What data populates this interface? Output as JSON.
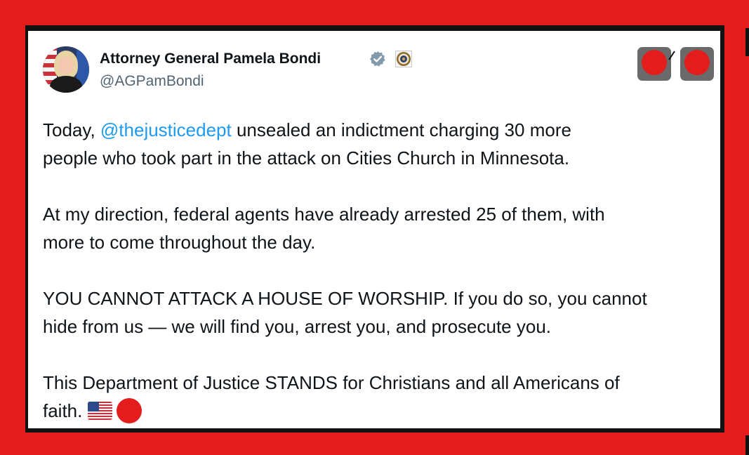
{
  "post": {
    "author_name": "Attorney General Pamela Bondi",
    "handle": "@AGPamBondi",
    "paragraph1": {
      "prefix": "Today, ",
      "mention": "@thejusticedept",
      "line1_rest": " unsealed an indictment charging 30 more",
      "line2": "people who took part in the attack on Cities Church in Minnesota."
    },
    "paragraph2": {
      "line1": "At my direction, federal agents have already arrested 25 of them, with",
      "line2": "more to come throughout the day."
    },
    "paragraph3": {
      "line1": "YOU CANNOT ATTACK A HOUSE OF WORSHIP. If you do so, you cannot",
      "line2": "hide from us — we will find you, arrest you, and prosecute you."
    },
    "paragraph4": {
      "line1": "This Department of Justice STANDS for Christians and all Americans of",
      "line2": "faith."
    }
  },
  "icons": {
    "verified": "verified-badge-icon",
    "seal": "doj-seal-icon",
    "flag": "us-flag-emoji-icon"
  },
  "colors": {
    "frame": "#e31d1c",
    "mention": "#1d9bf0",
    "text": "#0f1419",
    "handle": "#536471",
    "verified": "#829aab",
    "redaction": "#e31d1c"
  }
}
